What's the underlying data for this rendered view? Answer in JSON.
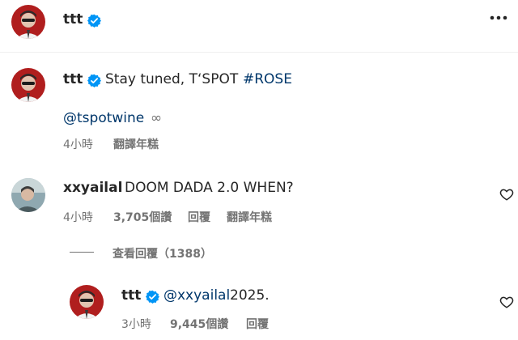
{
  "header": {
    "username": "ttt",
    "more_icon": "more-horizontal-icon"
  },
  "post": {
    "username": "ttt",
    "caption_text": "Stay tuned, T‘SPOT",
    "hashtag": "#ROSE",
    "mention": "@tspotwine",
    "mention_suffix": "∞",
    "time": "4小時",
    "translate": "翻譯年糕"
  },
  "comments": [
    {
      "username": "xxyailal",
      "text": "DOOM DADA 2.0 WHEN?",
      "time": "4小時",
      "likes": "3,705個讚",
      "reply": "回覆",
      "translate": "翻譯年糕",
      "view_replies": "查看回覆（1388）"
    }
  ],
  "reply": {
    "username": "ttt",
    "mention": "@xxyailal",
    "text": "2025.",
    "time": "3小時",
    "likes": "9,445個讚",
    "reply": "回覆"
  },
  "colors": {
    "verified": "#0095f6",
    "link": "#00376b",
    "meta": "#737373"
  }
}
